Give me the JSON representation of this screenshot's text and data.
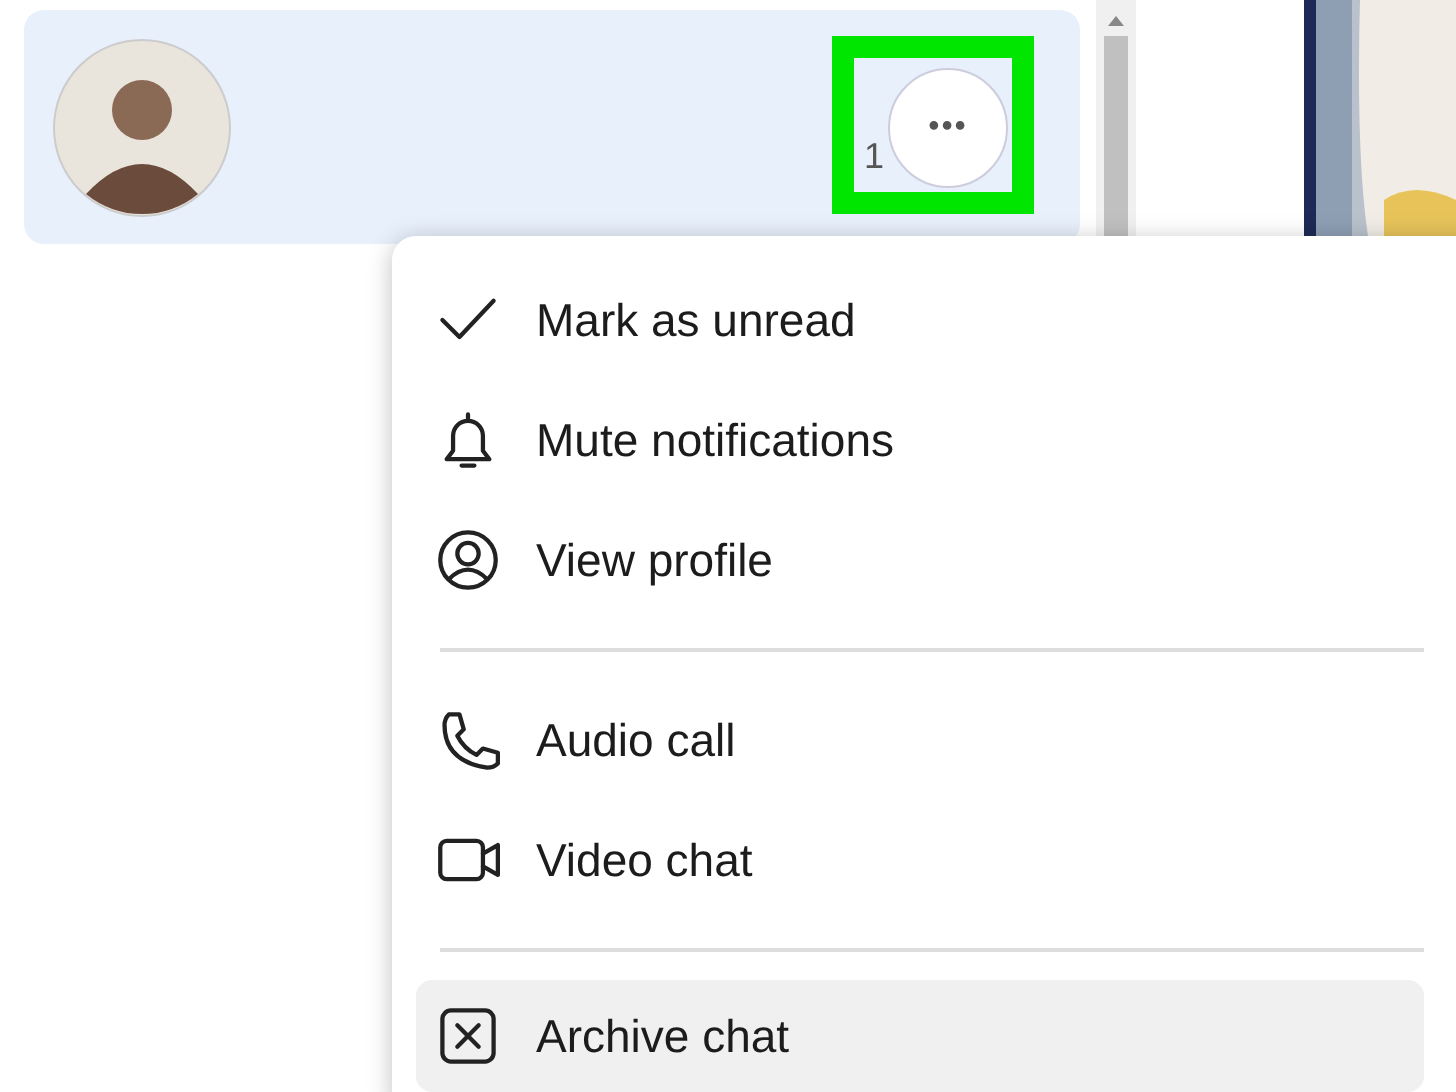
{
  "chat_row": {
    "time": "1",
    "more_button": {
      "label": "•••",
      "highlighted": true
    }
  },
  "menu": {
    "groups": [
      {
        "items": [
          {
            "kind": "check",
            "label": "Mark as unread",
            "hovered": false
          },
          {
            "kind": "bell",
            "label": "Mute notifications",
            "hovered": false
          },
          {
            "kind": "profile",
            "label": "View profile",
            "hovered": false
          }
        ]
      },
      {
        "items": [
          {
            "kind": "phone",
            "label": "Audio call",
            "hovered": false
          },
          {
            "kind": "video",
            "label": "Video chat",
            "hovered": false
          }
        ]
      },
      {
        "items": [
          {
            "kind": "archive",
            "label": "Archive chat",
            "hovered": true
          }
        ]
      }
    ]
  }
}
